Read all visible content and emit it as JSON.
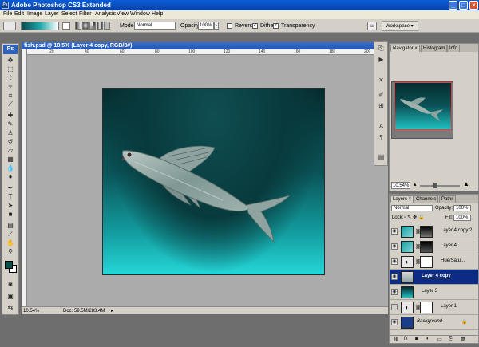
{
  "window": {
    "title": "Adobe Photoshop CS3 Extended",
    "minimize": "_",
    "maximize": "□",
    "close": "×"
  },
  "menu": [
    "File",
    "Edit",
    "Image",
    "Layer",
    "Select",
    "Filter",
    "Analysis",
    "View",
    "Window",
    "Help"
  ],
  "options": {
    "mode_label": "Mode:",
    "mode_value": "Normal",
    "opacity_label": "Opacity:",
    "opacity_value": "100%",
    "reverse_label": "Reverse",
    "dither_label": "Dither",
    "transparency_label": "Transparency",
    "workspace_label": "Workspace ▾"
  },
  "document": {
    "title": "fish.psd @ 10.5% (Layer 4 copy, RGB/8#)",
    "ruler_ticks": [
      "20",
      "40",
      "60",
      "80",
      "100",
      "120",
      "140",
      "160",
      "180",
      "200"
    ],
    "zoom": "10.54%",
    "doc_size": "Doc: 59.5M/283.4M"
  },
  "navigator": {
    "tabs": [
      "Navigator ×",
      "Histogram",
      "Info"
    ],
    "zoom": "10.54%"
  },
  "layers": {
    "tabs": [
      "Layers ×",
      "Channels",
      "Paths"
    ],
    "blend_mode": "Normal",
    "opacity_label": "Opacity:",
    "opacity_value": "100%",
    "lock_label": "Lock:",
    "fill_label": "Fill:",
    "fill_value": "100%",
    "items": [
      {
        "name": "Layer 4 copy 2",
        "visible": true,
        "active": false
      },
      {
        "name": "Layer 4",
        "visible": true,
        "active": false
      },
      {
        "name": "Hue/Satu...",
        "visible": true,
        "active": false
      },
      {
        "name": "Layer 4 copy",
        "visible": true,
        "active": true
      },
      {
        "name": "Layer 3",
        "visible": true,
        "active": false
      },
      {
        "name": "Layer 1",
        "visible": false,
        "active": false
      },
      {
        "name": "Background",
        "visible": true,
        "active": false
      }
    ],
    "footer_icons": [
      "link-icon",
      "fx-icon",
      "mask-icon",
      "adjustment-icon",
      "group-icon",
      "new-layer-icon",
      "trash-icon"
    ]
  },
  "colors": {
    "accent": "#0a5dd8",
    "selection": "#0c2c84",
    "foreground_swatch": "#0b4f4a",
    "background_swatch": "#ffffff"
  }
}
